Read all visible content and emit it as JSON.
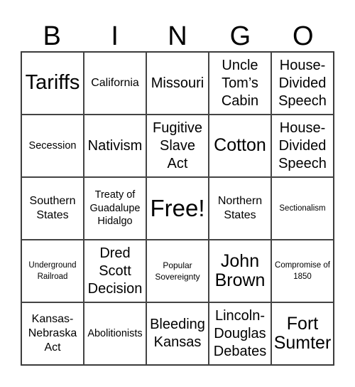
{
  "header": {
    "letters": [
      "B",
      "I",
      "N",
      "G",
      "O"
    ]
  },
  "cells": [
    "Tariffs",
    "California",
    "Missouri",
    "Uncle Tom’s Cabin",
    "House-Divided Speech",
    "Secession",
    "Nativism",
    "Fugitive Slave Act",
    "Cotton",
    "House-Divided Speech",
    "Southern States",
    "Treaty of Guadalupe Hidalgo",
    "Free!",
    "Northern States",
    "Sectionalism",
    "Underground Railroad",
    "Dred Scott Decision",
    "Popular Sovereignty",
    "John Brown",
    "Compromise of 1850",
    "Kansas-Nebraska Act",
    "Abolitionists",
    "Bleeding Kansas",
    "Lincoln-Douglas Debates",
    "Fort Sumter"
  ]
}
